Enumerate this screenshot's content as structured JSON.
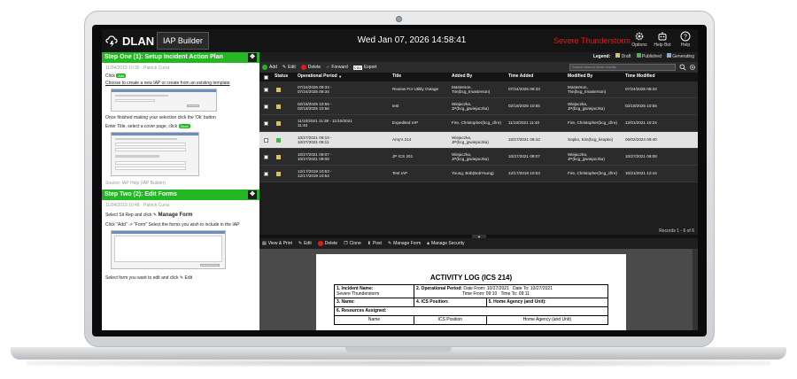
{
  "app": {
    "logo_text": "DLAN",
    "tab": "IAP Builder",
    "clock": "Wed Jan 07, 2026 14:58:41",
    "alert": "Severe Thunderstorm",
    "top_icons": [
      {
        "icon": "gear-icon",
        "label": "Options"
      },
      {
        "icon": "robot-icon",
        "label": "Help Bot"
      },
      {
        "icon": "question-icon",
        "label": "Help"
      }
    ]
  },
  "left": {
    "step1": {
      "title": "Step One (1): Setup Incident Action Plan",
      "meta": "11/04/2019 10:30 · Patrick Curra",
      "click": "Click",
      "add_label": "Add",
      "choose": "Choose to create a new IAP or create from an existing template",
      "ok_text": "Once finished making your selection click the 'Ok' button",
      "enter_title": "Enter Title, select a cover page, click",
      "save_label": "Save",
      "source": "Source: IAP Help (IAP Builder)"
    },
    "step2": {
      "title": "Step Two (2): Edit Forms",
      "meta": "11/04/2019 10:48 · Patrick Curra",
      "select_text": "Select Sit Rep and click",
      "manage_form": "Manage Form",
      "click_add": "Click \"Add\" -> \"Form\" Select the forms you wish to include in the IAP",
      "select_edit": "Select form you want to edit and click",
      "edit_label": "Edit"
    }
  },
  "legend": {
    "label": "Legend:",
    "draft": "Draft",
    "published": "Published",
    "generating": "Generating"
  },
  "actions": {
    "add": "Add",
    "edit": "Edit",
    "delete": "Delete",
    "forward": "Forward",
    "export": "Export",
    "export_badge": "CSV",
    "search_placeholder": "Search search these results"
  },
  "table": {
    "headers": [
      "Status",
      "Operational Period",
      "Title",
      "Added By",
      "Time Added",
      "Modified By",
      "Time Modified"
    ],
    "sort_arrow": "▼",
    "rows": [
      {
        "status": "draft",
        "period": "07/24/2025 09:33 - 07/24/2025 09:34",
        "title": "Review For Utility Outage",
        "added_by": "Masterson, Tim(bcg_tmasterson)",
        "time_added": "07/24/2025 08:33",
        "modified_by": "Masterson, Tim(bcg_tmasterson)",
        "time_modified": "07/24/2025 08:34"
      },
      {
        "status": "draft",
        "period": "02/18/2025 10:55 - 02/18/2025 10:56",
        "title": "test",
        "added_by": "Wiejaczka, JP(bcg_jpwiejaczka)",
        "time_added": "02/18/2025 10:55",
        "modified_by": "Wiejaczka, JP(bcg_jpwiejaczka)",
        "time_modified": "02/18/2025 10:56"
      },
      {
        "status": "draft",
        "period": "11/10/2021 11:39 - 11/10/2021 11:40",
        "title": "Expedited IAP",
        "added_by": "Fire, Christopher(bcg_cfire)",
        "time_added": "11/10/2021 11:40",
        "modified_by": "Fire, Christopher(bcg_cfire)",
        "time_modified": "12/01/2021 10:24"
      },
      {
        "status": "published",
        "period": "10/27/2021 09:10 - 10/27/2021 09:11",
        "title": "Amy's 214",
        "added_by": "Wiejaczka, JP(bcg_jpwiejaczka)",
        "time_added": "10/27/2021 06:10",
        "modified_by": "Sopko, Kim(bcg_ksopko)",
        "time_modified": "06/02/2024 09:40"
      },
      {
        "status": "draft",
        "period": "10/27/2021 09:07 - 10/27/2021 09:08",
        "title": "JP ICS 201",
        "added_by": "Wiejaczka, JP(bcg_jpwiejaczka)",
        "time_added": "10/27/2021 08:07",
        "modified_by": "Wiejaczka, JP(bcg_jpwiejaczka)",
        "time_modified": "10/27/2021 06:08"
      },
      {
        "status": "draft",
        "period": "12/17/2019 10:53 - 12/17/2019 10:54",
        "title": "Test IAP",
        "added_by": "Young, Bob(BobYoung)",
        "time_added": "12/17/2019 10:53",
        "modified_by": "Fire, Christopher(bcg_cfire)",
        "time_modified": "10/21/2021 12:44"
      }
    ],
    "records": "Records 1 - 6 of 6"
  },
  "preview": {
    "toolbar": [
      "View & Print",
      "Edit",
      "Delete",
      "Clone",
      "Post",
      "Manage Form",
      "Manage Security"
    ],
    "doc_title": "ACTIVITY LOG (ICS 214)",
    "incident_name_label": "1. Incident Name:",
    "incident_name": "Severe Thunderstorm",
    "op_period_label": "2. Operational Period:",
    "date_from_label": "Date From:",
    "date_from": "10/27/2021",
    "date_to_label": "Date To:",
    "date_to": "10/27/2021",
    "time_from_label": "Time From:",
    "time_from": "09:10",
    "time_to_label": "Time To:",
    "time_to": "09:11",
    "name_label": "3. Name:",
    "ics_position_label": "4. ICS Position:",
    "home_agency_label": "5. Home Agency (and Unit):",
    "resources_label": "6. Resources Assigned:",
    "col_name": "Name",
    "col_ics": "ICS Position",
    "col_agency": "Home Agency (and Unit)"
  }
}
